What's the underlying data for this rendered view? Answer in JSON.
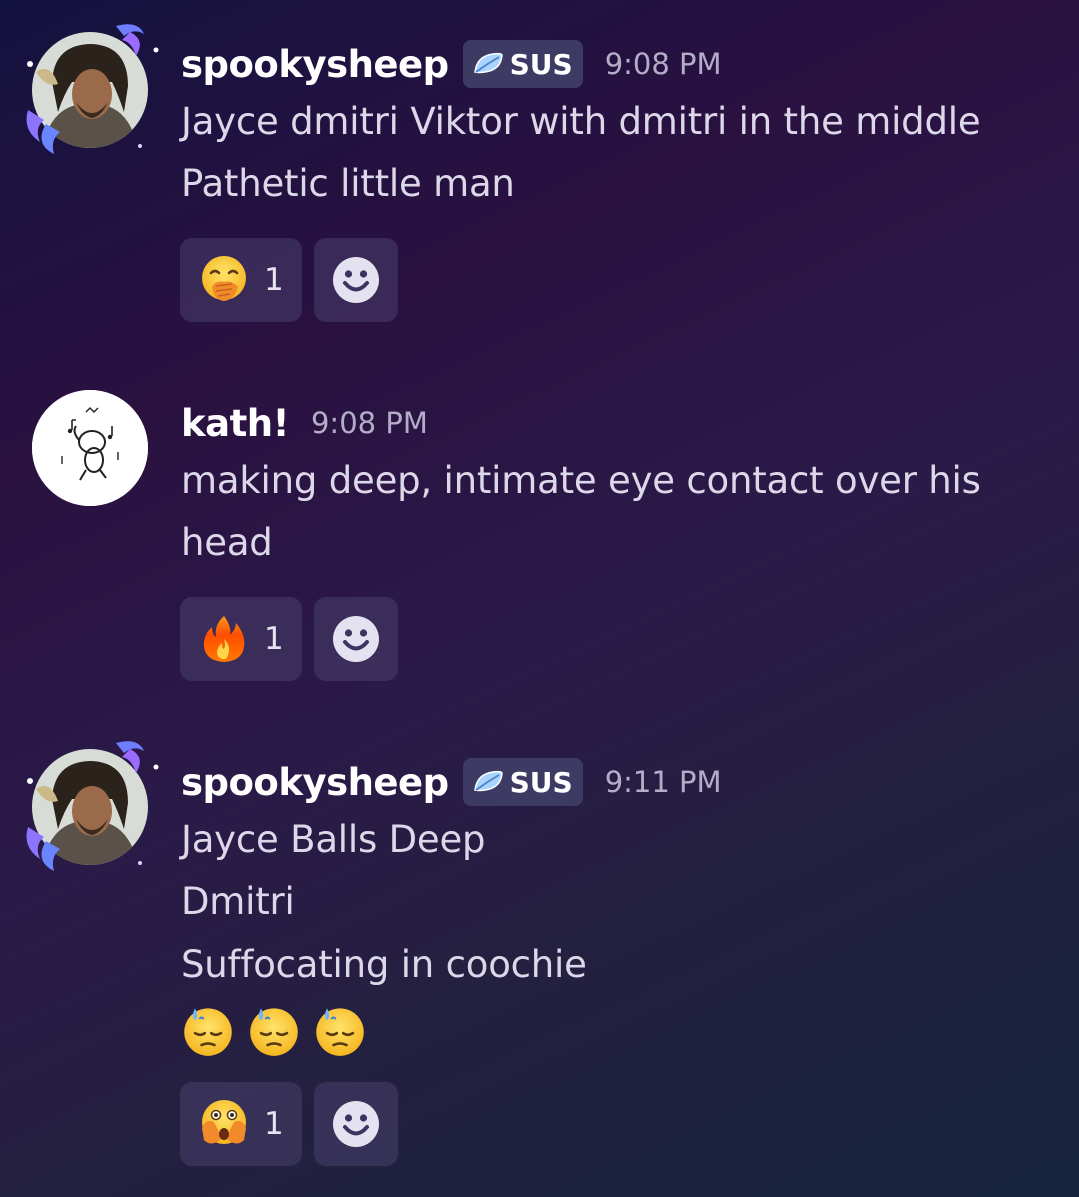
{
  "messages": [
    {
      "username": "spookysheep",
      "tag": "SUS",
      "time": "9:08 PM",
      "lines": [
        "Jayce dmitri Viktor with dmitri in the middle",
        "Pathetic little man"
      ],
      "reaction": {
        "emoji": "face-with-hand-over-mouth-icon",
        "count": "1"
      }
    },
    {
      "username": "kath!",
      "time": "9:08 PM",
      "lines": [
        "making deep, intimate eye contact over his",
        "head"
      ],
      "reaction": {
        "emoji": "fire-icon",
        "count": "1"
      }
    },
    {
      "username": "spookysheep",
      "tag": "SUS",
      "time": "9:11 PM",
      "lines": [
        "Jayce Balls Deep",
        "Dmitri",
        "Suffocating in coochie"
      ],
      "emojis": [
        "downcast-sweat-face-icon",
        "downcast-sweat-face-icon",
        "downcast-sweat-face-icon"
      ],
      "reaction": {
        "emoji": "face-with-open-eyes-hand-over-mouth-icon",
        "count": "1"
      }
    }
  ],
  "colors": {
    "username": "#ffffff",
    "text": "#dcd8ea",
    "timestamp": "#b3adc8",
    "tag_bg": "#3d3a63",
    "reaction_bg": "#3c3760"
  }
}
